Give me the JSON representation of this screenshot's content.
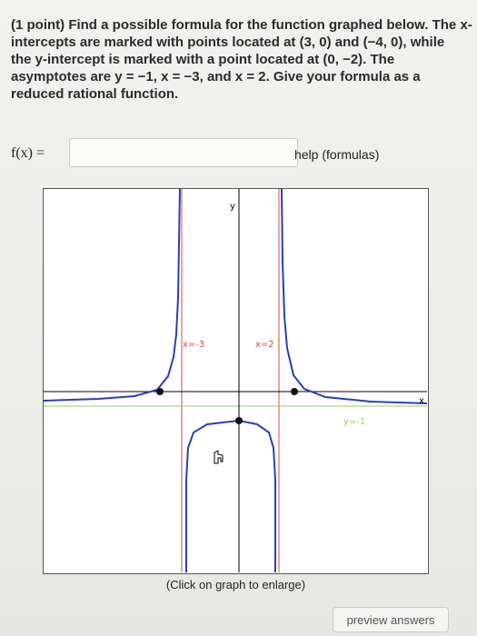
{
  "problem": {
    "lines": [
      "(1 point) Find a possible formula for the function graphed below. The x-",
      "intercepts are marked with points located at (3, 0) and (−4, 0), while",
      "the y-intercept is marked with a point located at (0, −2). The",
      "asymptotes are y = −1, x = −3, and x = 2. Give your formula as a",
      "reduced rational function."
    ]
  },
  "answer": {
    "label": "f(x) =",
    "value": "",
    "help_link": "help (formulas)"
  },
  "graph": {
    "y_axis_label": "y",
    "x_axis_label": "x",
    "asymptote_labels": [
      "x=-3",
      "x=2",
      "y=-1"
    ],
    "caption": "(Click on graph to enlarge)",
    "colors": {
      "curve": "#2a3fb5",
      "vertical_asymptote": "#d94a4a",
      "horizontal_asymptote": "#8fd16b",
      "axis": "#000000"
    }
  },
  "preview_button": {
    "label": "preview answers"
  }
}
